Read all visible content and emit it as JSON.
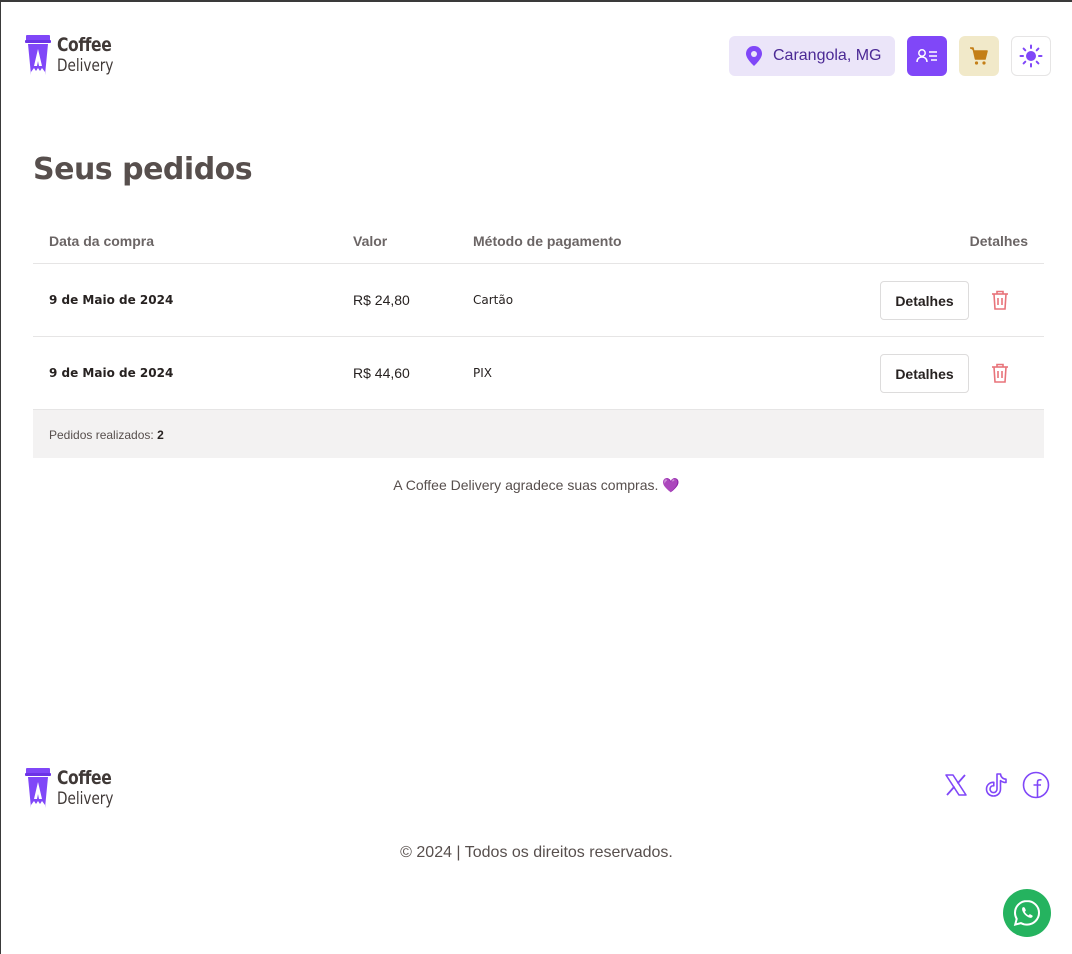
{
  "header": {
    "logo": {
      "line1": "Coffee",
      "line2": "Delivery"
    },
    "location": "Carangola, MG",
    "buttons": {
      "user_icon": "user-list-icon",
      "cart_icon": "cart-icon",
      "theme_icon": "sun-icon"
    }
  },
  "page": {
    "title": "Seus pedidos"
  },
  "table": {
    "headers": {
      "date": "Data da compra",
      "value": "Valor",
      "method": "Método de pagamento",
      "details": "Detalhes"
    },
    "rows": [
      {
        "date": "9 de Maio de 2024",
        "value": "R$ 24,80",
        "method": "Cartão",
        "details_button": "Detalhes"
      },
      {
        "date": "9 de Maio de 2024",
        "value": "R$ 44,60",
        "method": "PIX",
        "details_button": "Detalhes"
      }
    ],
    "footer": {
      "label": "Pedidos realizados:",
      "count": "2"
    }
  },
  "thanks": "A Coffee Delivery agradece suas compras. 💜",
  "footer": {
    "logo": {
      "line1": "Coffee",
      "line2": "Delivery"
    },
    "social": [
      "x-icon",
      "tiktok-icon",
      "facebook-icon"
    ],
    "copyright": "© 2024 | Todos os direitos reservados."
  },
  "colors": {
    "purple": "#8047F8",
    "purple_light": "#EBE5F9",
    "yellow": "#C47F17",
    "yellow_light": "#F1E9C9",
    "red": "#E8737A",
    "whatsapp": "#25B35F"
  }
}
